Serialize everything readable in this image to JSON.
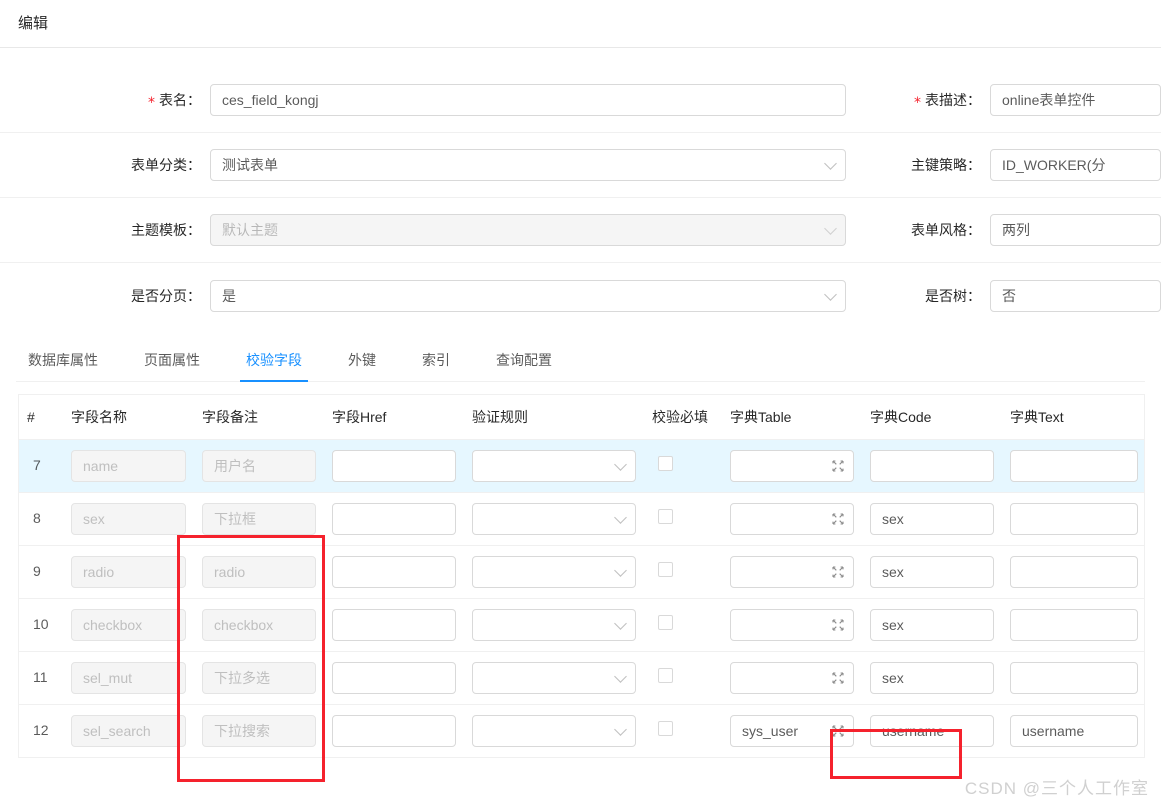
{
  "modal": {
    "title": "编辑"
  },
  "form": {
    "left_rows": [
      {
        "label": "表名",
        "required": true,
        "value": "ces_field_kongj",
        "type": "input",
        "disabled": false
      },
      {
        "label": "表单分类",
        "required": false,
        "value": "测试表单",
        "type": "select",
        "disabled": false
      },
      {
        "label": "主题模板",
        "required": false,
        "value": "默认主题",
        "type": "select",
        "disabled": true
      },
      {
        "label": "是否分页",
        "required": false,
        "value": "是",
        "type": "select",
        "disabled": false
      }
    ],
    "right_rows": [
      {
        "label": "表描述",
        "required": true,
        "value": "online表单控件",
        "type": "input",
        "disabled": false
      },
      {
        "label": "主键策略",
        "required": false,
        "value": "ID_WORKER(分",
        "type": "select",
        "disabled": false
      },
      {
        "label": "表单风格",
        "required": false,
        "value": "两列",
        "type": "select",
        "disabled": false
      },
      {
        "label": "是否树",
        "required": false,
        "value": "否",
        "type": "select",
        "disabled": false
      }
    ]
  },
  "tabs": {
    "items": [
      {
        "label": "数据库属性",
        "active": false
      },
      {
        "label": "页面属性",
        "active": false
      },
      {
        "label": "校验字段",
        "active": true
      },
      {
        "label": "外键",
        "active": false
      },
      {
        "label": "索引",
        "active": false
      },
      {
        "label": "查询配置",
        "active": false
      }
    ],
    "active_color": "#1890ff"
  },
  "table": {
    "columns": [
      "#",
      "字段名称",
      "字段备注",
      "字段Href",
      "验证规则",
      "校验必填",
      "字典Table",
      "字典Code",
      "字典Text"
    ],
    "rows": [
      {
        "index": "7",
        "highlight": true,
        "field_name": "name",
        "field_name_ghost": true,
        "field_memo": "用户名",
        "field_memo_ghost": true,
        "field_href": "",
        "rule": "",
        "required_checked": false,
        "dict_table": "",
        "dict_code": "",
        "dict_text": ""
      },
      {
        "index": "8",
        "highlight": false,
        "field_name": "sex",
        "field_name_ghost": true,
        "field_memo": "下拉框",
        "field_memo_ghost": true,
        "field_href": "",
        "rule": "",
        "required_checked": false,
        "dict_table": "",
        "dict_code": "sex",
        "dict_text": ""
      },
      {
        "index": "9",
        "highlight": false,
        "field_name": "radio",
        "field_name_ghost": true,
        "field_memo": "radio",
        "field_memo_ghost": true,
        "field_href": "",
        "rule": "",
        "required_checked": false,
        "dict_table": "",
        "dict_code": "sex",
        "dict_text": ""
      },
      {
        "index": "10",
        "highlight": false,
        "field_name": "checkbox",
        "field_name_ghost": true,
        "field_memo": "checkbox",
        "field_memo_ghost": true,
        "field_href": "",
        "rule": "",
        "required_checked": false,
        "dict_table": "",
        "dict_code": "sex",
        "dict_text": ""
      },
      {
        "index": "11",
        "highlight": false,
        "field_name": "sel_mut",
        "field_name_ghost": true,
        "field_memo": "下拉多选",
        "field_memo_ghost": true,
        "field_href": "",
        "rule": "",
        "required_checked": false,
        "dict_table": "",
        "dict_code": "sex",
        "dict_text": ""
      },
      {
        "index": "12",
        "highlight": false,
        "field_name": "sel_search",
        "field_name_ghost": true,
        "field_memo": "下拉搜索",
        "field_memo_ghost": true,
        "field_href": "",
        "rule": "",
        "required_checked": false,
        "dict_table": "sys_user",
        "dict_code": "username",
        "dict_text": "username"
      }
    ]
  },
  "annotations": {
    "boxes": [
      {
        "name": "field-memo-column",
        "color": "#f5222d"
      },
      {
        "name": "dict-code-cell-row11",
        "color": "#f5222d"
      }
    ]
  },
  "watermark": {
    "text": "CSDN @三个人工作室"
  }
}
